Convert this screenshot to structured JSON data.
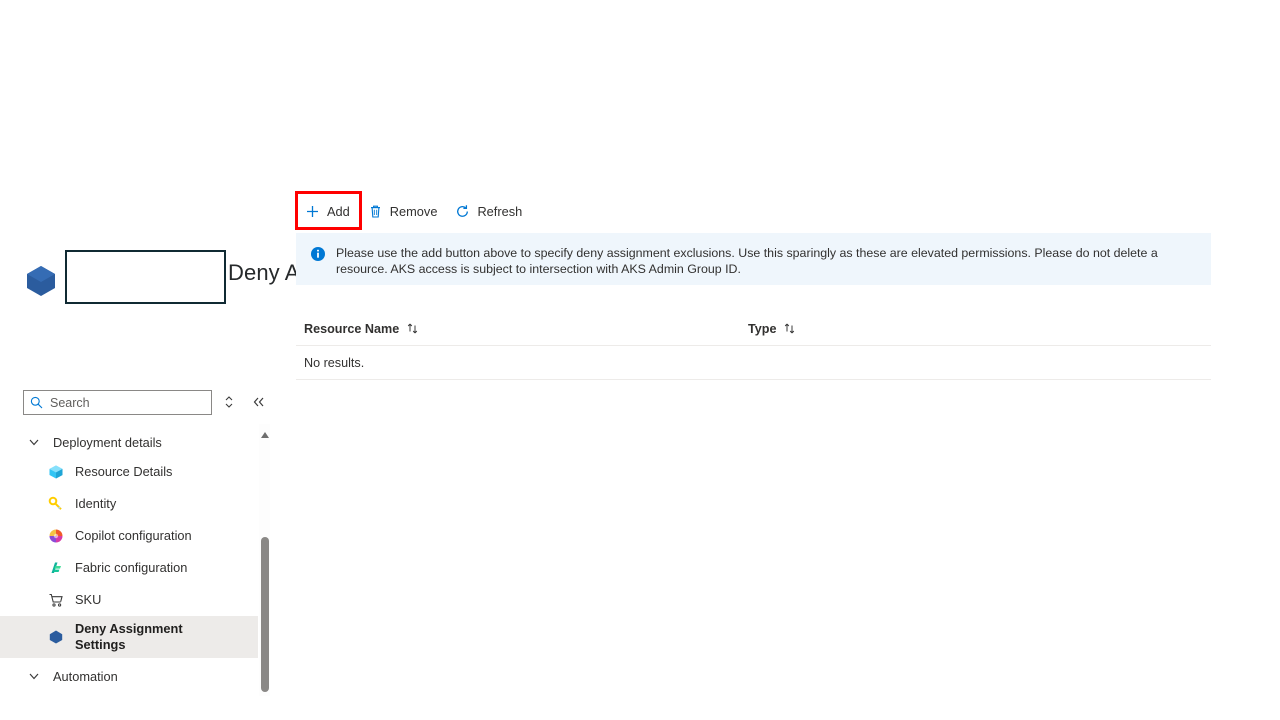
{
  "blade": {
    "title": "Deny Assignment Settings",
    "resource_icon": "hexagon-resource-icon",
    "favorite_icon": "star-outline-icon",
    "more_icon": "ellipsis-icon",
    "close_icon": "close-icon",
    "redacted_label": ""
  },
  "sidebar": {
    "search": {
      "placeholder": "Search",
      "value": "",
      "icon": "search-icon"
    },
    "expand_icon": "expand-collapse-icon",
    "collapse_icon": "double-chevron-left-icon",
    "groups": [
      {
        "label": "Deployment details",
        "chevron": "chevron-down-icon",
        "expanded": true,
        "items": [
          {
            "label": "Resource Details",
            "icon": "cube-icon",
            "selected": false
          },
          {
            "label": "Identity",
            "icon": "key-icon",
            "selected": false
          },
          {
            "label": "Copilot configuration",
            "icon": "copilot-icon",
            "selected": false
          },
          {
            "label": "Fabric configuration",
            "icon": "fabric-icon",
            "selected": false
          },
          {
            "label": "SKU",
            "icon": "cart-icon",
            "selected": false
          },
          {
            "label": "Deny Assignment Settings",
            "icon": "hexagon-icon",
            "selected": true
          }
        ]
      },
      {
        "label": "Automation",
        "chevron": "chevron-down-icon",
        "expanded": false,
        "items": []
      }
    ],
    "scrollbar": {
      "up_arrow_icon": "scroll-up-arrow-icon"
    }
  },
  "toolbar": {
    "commands": [
      {
        "label": "Add",
        "icon": "plus-icon",
        "highlighted": true
      },
      {
        "label": "Remove",
        "icon": "trash-icon",
        "highlighted": false
      },
      {
        "label": "Refresh",
        "icon": "refresh-icon",
        "highlighted": false
      }
    ],
    "highlight_color": "#ff0000"
  },
  "banner": {
    "icon": "info-icon",
    "text": "Please use the add button above to specify deny assignment exclusions. Use this sparingly as these are elevated permissions. Please do not delete a resource. AKS access is subject to intersection with AKS Admin Group ID.",
    "background": "#eff6fc",
    "accent": "#0078d4"
  },
  "table": {
    "columns": [
      {
        "label": "Resource Name",
        "sort_icon": "sort-arrows-icon"
      },
      {
        "label": "Type",
        "sort_icon": "sort-arrows-icon"
      }
    ],
    "rows": [],
    "empty_message": "No results."
  }
}
